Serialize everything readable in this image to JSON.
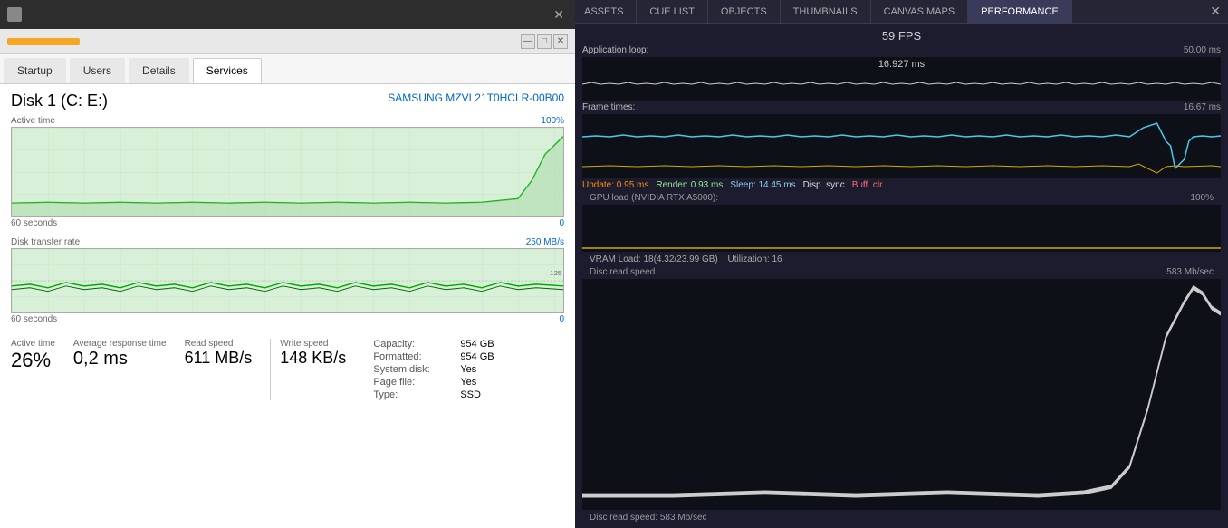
{
  "left": {
    "titlebar": {
      "close_label": "✕"
    },
    "top_controls": {
      "minimize": "—",
      "maximize": "□",
      "close": "✕"
    },
    "tabs": [
      {
        "label": "Startup",
        "active": false
      },
      {
        "label": "Users",
        "active": false
      },
      {
        "label": "Details",
        "active": false
      },
      {
        "label": "Services",
        "active": true
      }
    ],
    "disk": {
      "title": "Disk 1 (C: E:)",
      "model": "SAMSUNG MZVL21T0HCLR-00B00",
      "active_time_label": "Active time",
      "active_time_max": "100%",
      "time_range": "60 seconds",
      "time_range_value": "0",
      "transfer_label": "Disk transfer rate",
      "transfer_max": "250 MB/s",
      "transfer_mid": "125 MB/s",
      "transfer_footer": "60 seconds",
      "transfer_footer_val": "0",
      "active_time_pct": "26%",
      "active_time_stat_label": "Active time",
      "avg_resp_label": "Average response time",
      "avg_resp_value": "0,2 ms",
      "capacity_label": "Capacity:",
      "capacity_val": "954 GB",
      "formatted_label": "Formatted:",
      "formatted_val": "954 GB",
      "system_disk_label": "System disk:",
      "system_disk_val": "Yes",
      "page_file_label": "Page file:",
      "page_file_val": "Yes",
      "type_label": "Type:",
      "type_val": "SSD",
      "read_speed_label": "Read speed",
      "read_speed_val": "611 MB/s",
      "write_speed_label": "Write speed",
      "write_speed_val": "148 KB/s"
    }
  },
  "right": {
    "tabs": [
      {
        "label": "ASSETS",
        "active": false
      },
      {
        "label": "CUE LIST",
        "active": false
      },
      {
        "label": "OBJECTS",
        "active": false
      },
      {
        "label": "THUMBNAILS",
        "active": false
      },
      {
        "label": "CANVAS MAPS",
        "active": false
      },
      {
        "label": "PERFORMANCE",
        "active": true
      }
    ],
    "fps": "59 FPS",
    "app_loop_label": "Application loop:",
    "app_loop_right": "50.00 ms",
    "app_loop_value": "16.927 ms",
    "frame_times_label": "Frame times:",
    "frame_times_right": "16.67 ms",
    "timing_update": "Update: 0.95 ms",
    "timing_render": "Render: 0.93 ms",
    "timing_sleep": "Sleep: 14.45 ms",
    "timing_disp": "Disp. sync",
    "timing_buff": "Buff. clr.",
    "gpu_label": "GPU load (NVIDIA RTX A5000):",
    "gpu_right": "100%",
    "vram_label": "VRAM Load: 18(4.32/23.99 GB)",
    "vram_util": "Utilization: 16",
    "disc_label": "Disc read speed",
    "disc_right": "583 Mb/sec",
    "disc_bottom": "Disc read speed: 583 Mb/sec"
  }
}
